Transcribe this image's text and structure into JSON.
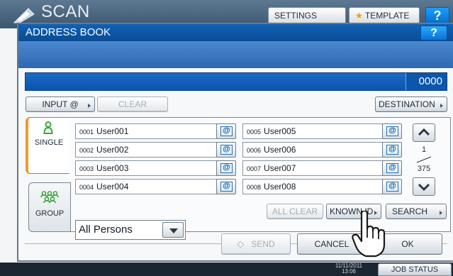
{
  "background": {
    "title": "SCAN",
    "settings_tab": "SETTINGS",
    "template_tab": "TEMPLATE",
    "help": "?",
    "datetime_line1": "11/11/2011",
    "datetime_line2": "13:06",
    "job_status": "JOB STATUS"
  },
  "dialog": {
    "title": "ADDRESS BOOK",
    "help": "?",
    "count": "0000",
    "input_button": "INPUT @",
    "clear_button": "CLEAR",
    "destination_button": "DESTINATION",
    "tabs": [
      {
        "label": "SINGLE",
        "icon": "person-icon"
      },
      {
        "label": "GROUP",
        "icon": "group-icon"
      }
    ],
    "entries": [
      {
        "num": "0001",
        "name": "User001"
      },
      {
        "num": "0002",
        "name": "User002"
      },
      {
        "num": "0003",
        "name": "User003"
      },
      {
        "num": "0004",
        "name": "User004"
      },
      {
        "num": "0005",
        "name": "User005"
      },
      {
        "num": "0006",
        "name": "User006"
      },
      {
        "num": "0007",
        "name": "User007"
      },
      {
        "num": "0008",
        "name": "User008"
      }
    ],
    "mail_symbol": "@",
    "page_current": "1",
    "page_total": "375",
    "filter_value": "All Persons",
    "all_clear_button": "ALL CLEAR",
    "known_id_button": "KNOWN ID",
    "search_button": "SEARCH",
    "send_button": "SEND",
    "cancel_button": "CANCEL",
    "ok_button": "OK"
  },
  "colors": {
    "title_blue": "#0e62b8",
    "single_tab_accent": "#f09a2a",
    "icon_green": "#3aa63a"
  }
}
